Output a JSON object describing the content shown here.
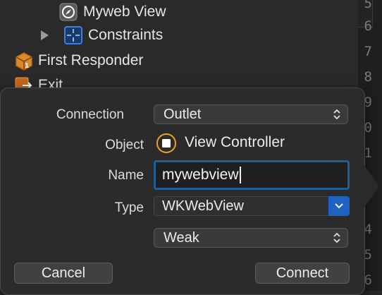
{
  "outline": {
    "items": [
      {
        "label": "Myweb View",
        "icon": "compass-icon"
      },
      {
        "label": "Constraints",
        "icon": "constraints-icon"
      },
      {
        "label": "First Responder",
        "icon": "cube-icon"
      },
      {
        "label": "Exit",
        "icon": "exit-icon"
      }
    ]
  },
  "gutter": {
    "line_numbers": [
      "5",
      "6",
      "7",
      "8",
      "9",
      "0",
      "1",
      "",
      "",
      "4",
      "5",
      "6"
    ]
  },
  "connection_dialog": {
    "connection": {
      "label": "Connection",
      "value": "Outlet"
    },
    "object": {
      "label": "Object",
      "value": "View Controller",
      "icon": "view-controller-icon"
    },
    "name": {
      "label": "Name",
      "value": "mywebview"
    },
    "type": {
      "label": "Type",
      "value": "WKWebView"
    },
    "storage": {
      "value": "Weak"
    },
    "cancel_label": "Cancel",
    "connect_label": "Connect"
  },
  "colors": {
    "accent_blue": "#1e63c4",
    "focus_ring": "#1f5f93",
    "object_orange": "#e7a226",
    "popover_bg": "#2b2b2c"
  }
}
